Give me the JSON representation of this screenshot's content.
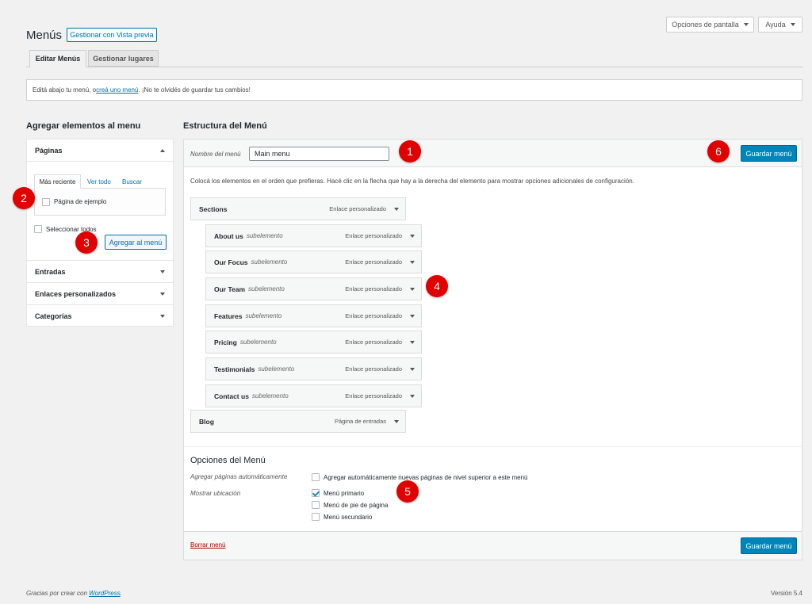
{
  "header": {
    "title": "Menús",
    "preview_button": "Gestionar con Vista previa",
    "screen_options": "Opciones de pantalla",
    "help": "Ayuda"
  },
  "tabs": [
    {
      "label": "Editar Menús",
      "active": true
    },
    {
      "label": "Gestionar lugares",
      "active": false
    }
  ],
  "notice": {
    "before": "Editá abajo tu menú, o ",
    "link": "creá uno menú",
    "after": ". ¡No te olvidés de guardar tus cambios!"
  },
  "sidebar": {
    "heading": "Agregar elementos al menu",
    "pages_section": {
      "title": "Páginas",
      "tabs": [
        "Más reciente",
        "Ver todo",
        "Buscar"
      ],
      "items": [
        {
          "label": "Página de ejemplo",
          "checked": false
        }
      ],
      "select_all": "Seleccionar todos",
      "add_button": "Agregar al menú"
    },
    "sections": [
      "Entradas",
      "Enlaces personalizados",
      "Categorías"
    ]
  },
  "structure": {
    "heading": "Estructura del Menú",
    "name_label": "Nombre del menú",
    "name_value": "Main menu",
    "save_button": "Guardar menú",
    "instructions": "Colocá los elementos en el orden que prefieras. Hacé clic en la flecha que hay a la derecha del elemento para mostrar opciones adicionales de configuración.",
    "items": [
      {
        "title": "Sections",
        "sub": "",
        "type": "Enlace personalizado"
      },
      {
        "title": "About us",
        "sub": "subelemento",
        "type": "Enlace personalizado"
      },
      {
        "title": "Our Focus",
        "sub": "subelemento",
        "type": "Enlace personalizado"
      },
      {
        "title": "Our Team",
        "sub": "subelemento",
        "type": "Enlace personalizado"
      },
      {
        "title": "Features",
        "sub": "subelemento",
        "type": "Enlace personalizado"
      },
      {
        "title": "Pricing",
        "sub": "subelemento",
        "type": "Enlace personalizado"
      },
      {
        "title": "Testimonials",
        "sub": "subelemento",
        "type": "Enlace personalizado"
      },
      {
        "title": "Contact us",
        "sub": "subelemento",
        "type": "Enlace personalizado"
      },
      {
        "title": "Blog",
        "sub": "",
        "type": "Página de entradas"
      }
    ],
    "options": {
      "heading": "Opciones del Menú",
      "auto_add_label": "Agregar páginas automáticamente",
      "auto_add_text": "Agregar automáticamente nuevas páginas de nivel superior a este menú",
      "auto_add_checked": false,
      "location_label": "Mostrar ubicación",
      "locations": [
        {
          "label": "Menú primario",
          "checked": true
        },
        {
          "label": "Menú de pie de página",
          "checked": false
        },
        {
          "label": "Menú secundario",
          "checked": false
        }
      ]
    },
    "delete_link": "Borrar menú"
  },
  "markers": [
    "1",
    "2",
    "3",
    "4",
    "5",
    "6"
  ],
  "footer": {
    "thanks_before": "Gracias por crear con ",
    "thanks_link": "WordPress",
    "thanks_after": ".",
    "version": "Versión 5.4"
  },
  "colors": {
    "primary": "#0085ba",
    "link": "#0073aa",
    "marker": "#e00000",
    "background": "#f1f1f1"
  }
}
